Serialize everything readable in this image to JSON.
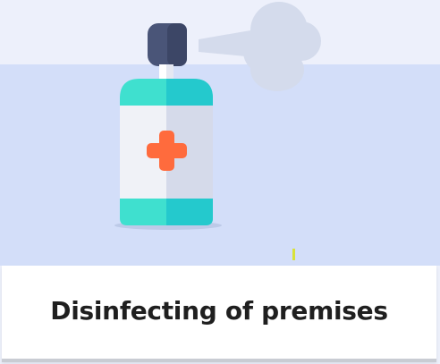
{
  "card": {
    "title": "Disinfecting of premises",
    "icons": [
      "sanitizer-bottle-icon",
      "spray-cloud-icon",
      "medical-cross-icon"
    ]
  },
  "colors": {
    "background": "#edf0fb",
    "panel": "#d3def9",
    "bottle_body": "#f0f2f7",
    "bottle_shade": "#d5daea",
    "bottle_band": "#3fe0cf",
    "bottle_band_shade": "#24c9cd",
    "nozzle": "#4a5578",
    "cross": "#ff6b3d",
    "spray": "#d4dbec"
  }
}
